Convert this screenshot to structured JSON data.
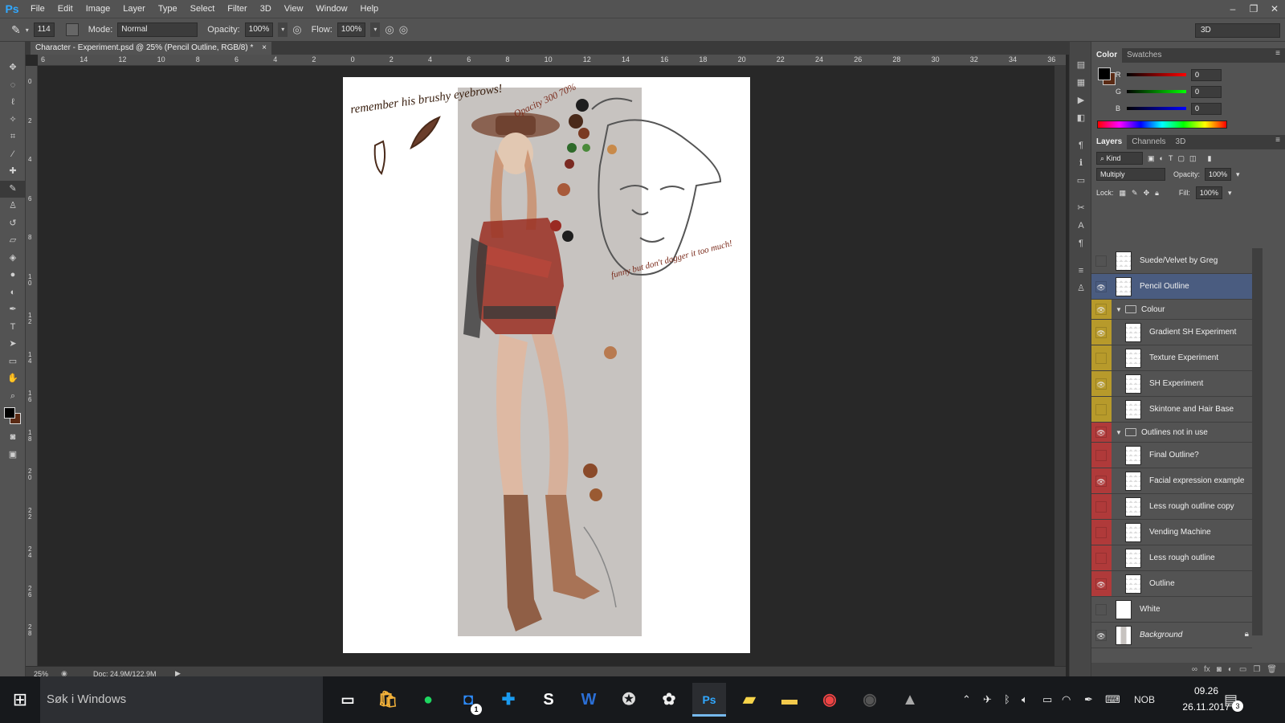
{
  "app": {
    "logo": "Ps",
    "menus": [
      "File",
      "Edit",
      "Image",
      "Layer",
      "Type",
      "Select",
      "Filter",
      "3D",
      "View",
      "Window",
      "Help"
    ],
    "window_controls": [
      "–",
      "❐",
      "✕"
    ]
  },
  "options": {
    "brush_size": "114",
    "mode_label": "Mode:",
    "mode_value": "Normal",
    "opacity_label": "Opacity:",
    "opacity_value": "100%",
    "flow_label": "Flow:",
    "flow_value": "100%",
    "workspace": "3D"
  },
  "document": {
    "tab_title": "Character - Experiment.psd @ 25% (Pencil Outline, RGB/8) *",
    "tab_close": "×",
    "zoom": "25%",
    "doc_size": "Doc: 24,9M/122,9M",
    "ruler_top": [
      "6",
      "14",
      "12",
      "10",
      "8",
      "6",
      "4",
      "2",
      "0",
      "2",
      "4",
      "6",
      "8",
      "10",
      "12",
      "14",
      "16",
      "18",
      "20",
      "22",
      "24",
      "26",
      "28",
      "30",
      "32",
      "34",
      "36"
    ],
    "ruler_left": [
      "0",
      "2",
      "4",
      "6",
      "8",
      "1\n0",
      "1\n2",
      "1\n4",
      "1\n6",
      "1\n8",
      "2\n0",
      "2\n2",
      "2\n4",
      "2\n6",
      "2\n8"
    ],
    "notes": {
      "eyebrows": "remember his brushy eyebrows!",
      "opacity": "Opacity 300 70%",
      "dagger": "funny but don't dagger it too much!"
    }
  },
  "color_panel": {
    "tabs": [
      "Color",
      "Swatches"
    ],
    "r_label": "R",
    "r_value": "0",
    "g_label": "G",
    "g_value": "0",
    "b_label": "B",
    "b_value": "0"
  },
  "layers_panel": {
    "tabs": [
      "Layers",
      "Channels",
      "3D"
    ],
    "filter": "Kind",
    "blend_mode": "Multiply",
    "opacity_label": "Opacity:",
    "opacity_value": "100%",
    "lock_label": "Lock:",
    "fill_label": "Fill:",
    "fill_value": "100%",
    "layers": [
      {
        "name": "Suede/Velvet by Greg",
        "visible": false,
        "color": "none",
        "indent": 0,
        "group": false,
        "selected": false
      },
      {
        "name": "Pencil Outline",
        "visible": true,
        "color": "none",
        "indent": 0,
        "group": false,
        "selected": true
      },
      {
        "name": "Colour",
        "visible": true,
        "color": "#b79a2b",
        "indent": 0,
        "group": true,
        "selected": false
      },
      {
        "name": "Gradient SH Experiment",
        "visible": true,
        "color": "#b79a2b",
        "indent": 1,
        "group": false,
        "selected": false
      },
      {
        "name": "Texture Experiment",
        "visible": false,
        "color": "#b79a2b",
        "indent": 1,
        "group": false,
        "selected": false
      },
      {
        "name": "SH Experiment",
        "visible": true,
        "color": "#b79a2b",
        "indent": 1,
        "group": false,
        "selected": false
      },
      {
        "name": "Skintone and Hair Base",
        "visible": false,
        "color": "#b79a2b",
        "indent": 1,
        "group": false,
        "selected": false
      },
      {
        "name": "Outlines not in use",
        "visible": true,
        "color": "#b03a3a",
        "indent": 0,
        "group": true,
        "selected": false
      },
      {
        "name": "Final Outline?",
        "visible": false,
        "color": "#b03a3a",
        "indent": 1,
        "group": false,
        "selected": false
      },
      {
        "name": "Facial expression example",
        "visible": true,
        "color": "#b03a3a",
        "indent": 1,
        "group": false,
        "selected": false
      },
      {
        "name": "Less rough outline copy",
        "visible": false,
        "color": "#b03a3a",
        "indent": 1,
        "group": false,
        "selected": false
      },
      {
        "name": "Vending Machine",
        "visible": false,
        "color": "#b03a3a",
        "indent": 1,
        "group": false,
        "selected": false
      },
      {
        "name": "Less rough outline",
        "visible": false,
        "color": "#b03a3a",
        "indent": 1,
        "group": false,
        "selected": false
      },
      {
        "name": "Outline",
        "visible": true,
        "color": "#b03a3a",
        "indent": 1,
        "group": false,
        "selected": false
      },
      {
        "name": "White",
        "visible": false,
        "color": "none",
        "indent": 0,
        "group": false,
        "selected": false
      },
      {
        "name": "Background",
        "visible": true,
        "color": "none",
        "indent": 0,
        "group": false,
        "selected": false
      }
    ]
  },
  "taskbar": {
    "search_placeholder": "Søk i Windows",
    "language": "NOB",
    "time": "09.26",
    "date": "26.11.2017",
    "notifications": "3",
    "messenger_badge": "1"
  }
}
